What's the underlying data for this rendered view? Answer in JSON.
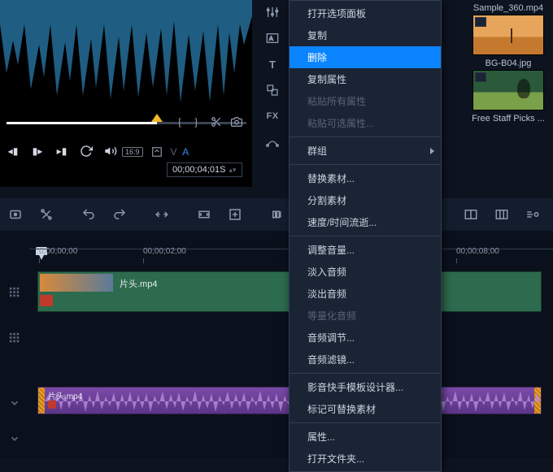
{
  "preview": {
    "timecode": "00;00;04;01S"
  },
  "aspect_badge": "16:9",
  "va": {
    "v": "V",
    "a": "A"
  },
  "right_tools": {
    "t_label": "T",
    "fx_label": "FX"
  },
  "assets": [
    {
      "name": "Sample_360.mp4",
      "thumb": "blue"
    },
    {
      "name": "BG-B04.jpg",
      "thumb": "desert"
    },
    {
      "name": "Free Staff Picks ...",
      "thumb": "staff"
    }
  ],
  "timeline": {
    "ticks": [
      "0;00;00;00",
      "00;00;02;00",
      "00;00;08;00"
    ],
    "video_clip": "片头.mp4",
    "audio_clip": "片头.mp4"
  },
  "context_menu": [
    {
      "label": "打开选项面板",
      "type": "item"
    },
    {
      "label": "复制",
      "type": "item"
    },
    {
      "label": "删除",
      "type": "selected"
    },
    {
      "label": "复制属性",
      "type": "item"
    },
    {
      "label": "粘贴所有属性",
      "type": "disabled"
    },
    {
      "label": "粘贴可选属性...",
      "type": "disabled"
    },
    {
      "type": "sep"
    },
    {
      "label": "群组",
      "type": "arrow"
    },
    {
      "type": "sep"
    },
    {
      "label": "替换素材...",
      "type": "item"
    },
    {
      "label": "分割素材",
      "type": "item"
    },
    {
      "label": "速度/时间流逝...",
      "type": "item"
    },
    {
      "type": "sep"
    },
    {
      "label": "调整音量...",
      "type": "item"
    },
    {
      "label": "淡入音频",
      "type": "item"
    },
    {
      "label": "淡出音频",
      "type": "item"
    },
    {
      "label": "等量化音频",
      "type": "disabled"
    },
    {
      "label": "音频调节...",
      "type": "item"
    },
    {
      "label": "音频滤镜...",
      "type": "item"
    },
    {
      "type": "sep"
    },
    {
      "label": "影音快手模板设计器...",
      "type": "item"
    },
    {
      "label": "标记可替换素材",
      "type": "item"
    },
    {
      "type": "sep"
    },
    {
      "label": "属性...",
      "type": "item"
    },
    {
      "label": "打开文件夹...",
      "type": "item"
    }
  ]
}
